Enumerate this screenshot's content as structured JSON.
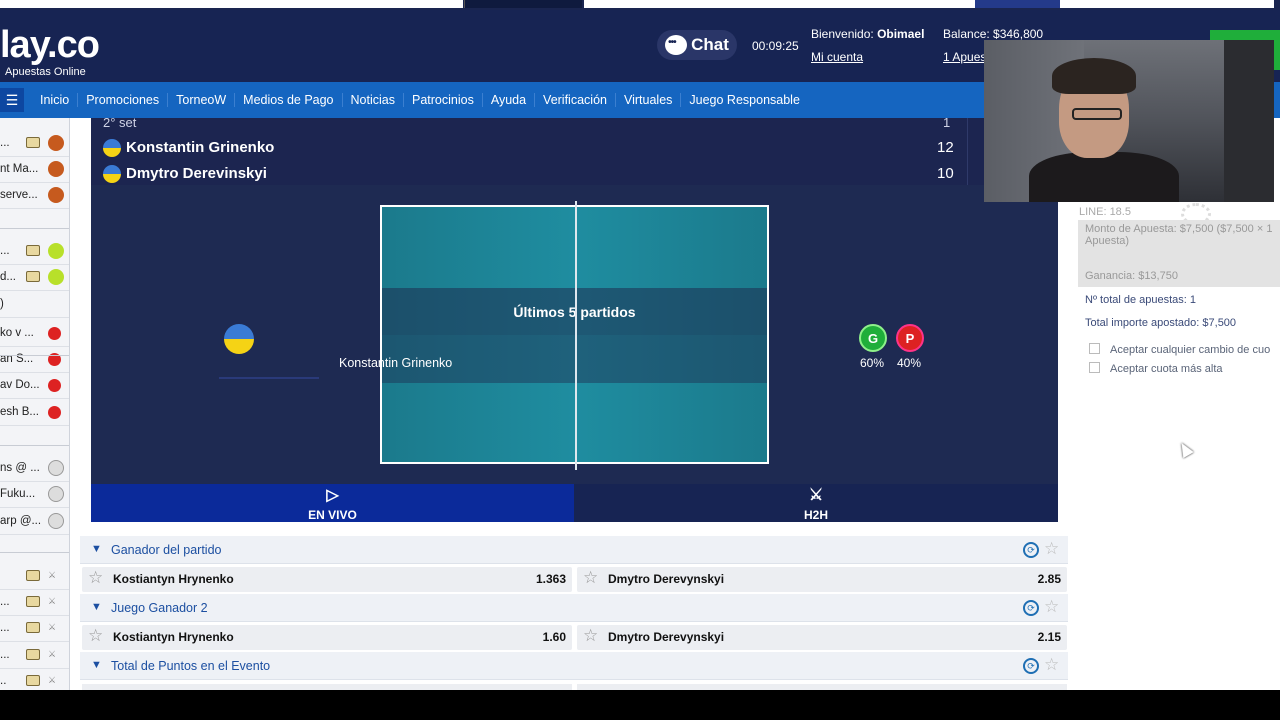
{
  "header": {
    "logo_text": "lay.co",
    "logo_sub": "Apuestas Online",
    "chat_label": "Chat",
    "timer": "00:09:25",
    "welcome_prefix": "Bienvenido:",
    "welcome_user": "Obimael",
    "account_link": "Mi cuenta",
    "balance": "Balance: $346,800",
    "bets_link": "1 Apues"
  },
  "nav": {
    "items": [
      "Inicio",
      "Promociones",
      "TorneoW",
      "Medios de Pago",
      "Noticias",
      "Patrocinios",
      "Ayuda",
      "Verificación",
      "Virtuales",
      "Juego Responsable"
    ]
  },
  "sidebar": {
    "rows": [
      {
        "text": "...",
        "sport": "basketball-icon",
        "tv": true
      },
      {
        "text": "nt Ma...",
        "sport": "basketball-icon",
        "tv": false
      },
      {
        "text": "serve...",
        "sport": "basketball-icon",
        "tv": false
      },
      {
        "text": "...",
        "sport": "tennis-ball-icon",
        "tv": true
      },
      {
        "text": "d...",
        "sport": "tennis-ball-icon",
        "tv": true
      },
      {
        "text": ")",
        "sport": "",
        "tv": false
      },
      {
        "text": "ko v ...",
        "sport": "ping-pong-icon",
        "tv": false
      },
      {
        "text": "an S...",
        "sport": "ping-pong-icon",
        "tv": false
      },
      {
        "text": "av Do...",
        "sport": "ping-pong-icon",
        "tv": false
      },
      {
        "text": "esh B...",
        "sport": "ping-pong-icon",
        "tv": false
      },
      {
        "text": "ns @ ...",
        "sport": "baseball-icon",
        "tv": false
      },
      {
        "text": "Fuku...",
        "sport": "baseball-icon",
        "tv": false
      },
      {
        "text": "arp @...",
        "sport": "baseball-icon",
        "tv": false
      },
      {
        "text": "",
        "sport": "versus-icon",
        "tv": true
      },
      {
        "text": "...",
        "sport": "versus-icon",
        "tv": true
      },
      {
        "text": "...",
        "sport": "versus-icon",
        "tv": true
      },
      {
        "text": "...",
        "sport": "versus-icon",
        "tv": true
      },
      {
        "text": "..",
        "sport": "versus-icon",
        "tv": true
      }
    ]
  },
  "match": {
    "set_label": "2° set",
    "set_value": "1",
    "player1": {
      "name": "Konstantin Grinenko",
      "score": "12"
    },
    "player2": {
      "name": "Dmytro Derevinskyi",
      "score": "10"
    },
    "court_title": "Últimos 5 partidos",
    "court_player": "Konstantin Grinenko",
    "form": {
      "win_label": "G",
      "loss_label": "P",
      "win_pct": "60%",
      "loss_pct": "40%"
    },
    "tabs": {
      "live": "EN VIVO",
      "h2h": "H2H"
    }
  },
  "markets": [
    {
      "title": "Ganador del partido",
      "odds": [
        {
          "name": "Kostiantyn Hrynenko",
          "value": "1.363"
        },
        {
          "name": "Dmytro Derevynskyi",
          "value": "2.85"
        }
      ]
    },
    {
      "title": "Juego Ganador 2",
      "odds": [
        {
          "name": "Kostiantyn Hrynenko",
          "value": "1.60"
        },
        {
          "name": "Dmytro Derevynskyi",
          "value": "2.15"
        }
      ]
    },
    {
      "title": "Total de Puntos en el Evento",
      "odds": []
    }
  ],
  "slip": {
    "line": "LINE: 18.5",
    "amount": "Monto de Apuesta: $7,500 ($7,500 × 1 Apuesta)",
    "gain": "Ganancia: $13,750",
    "total_bets": "Nº total de apuestas: 1",
    "total_amount": "Total importe apostado:  $7,500",
    "accept_change": "Aceptar cualquier cambio de cuo",
    "accept_higher": "Aceptar cuota más alta"
  },
  "colors": {
    "header_bg": "#172453",
    "nav_bg": "#1565c0",
    "live_tab": "#0b2a9a",
    "win": "#1fae3a",
    "loss": "#dd2222"
  }
}
